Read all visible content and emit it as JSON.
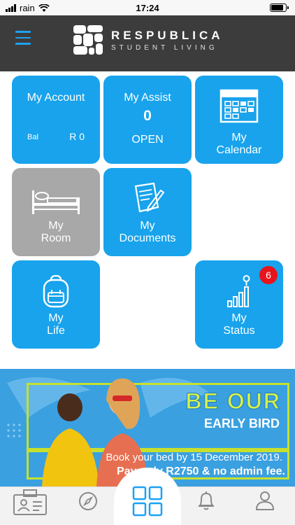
{
  "status_bar": {
    "carrier": "rain",
    "time": "17:24",
    "battery_level": 0.85
  },
  "header": {
    "brand_name": "RESPUBLICA",
    "brand_tagline": "STUDENT LIVING"
  },
  "tiles": {
    "account": {
      "title": "My Account",
      "bal_label": "Bal",
      "bal_value": "R 0"
    },
    "assist": {
      "title": "My Assist",
      "count": "0",
      "status": "OPEN"
    },
    "calendar": {
      "line1": "My",
      "line2": "Calendar"
    },
    "room": {
      "line1": "My",
      "line2": "Room"
    },
    "documents": {
      "line1": "My",
      "line2": "Documents"
    },
    "life": {
      "line1": "My",
      "line2": "Life"
    },
    "status": {
      "line1": "My",
      "line2": "Status",
      "badge": "6"
    }
  },
  "banner": {
    "headline": "BE OUR",
    "subheadline": "EARLY BIRD",
    "line1": "Book your bed by 15 December 2019.",
    "line2": "Pay only R2750 & no admin fee."
  },
  "nav": {
    "items": [
      "id-card-icon",
      "compass-icon",
      "grid-icon",
      "bell-icon",
      "user-icon"
    ],
    "accent": "#1da1f2"
  },
  "colors": {
    "tile_blue": "#18a3ec",
    "tile_gray": "#a8a8a8",
    "header": "#3c3c3c",
    "badge": "#e8141c"
  }
}
